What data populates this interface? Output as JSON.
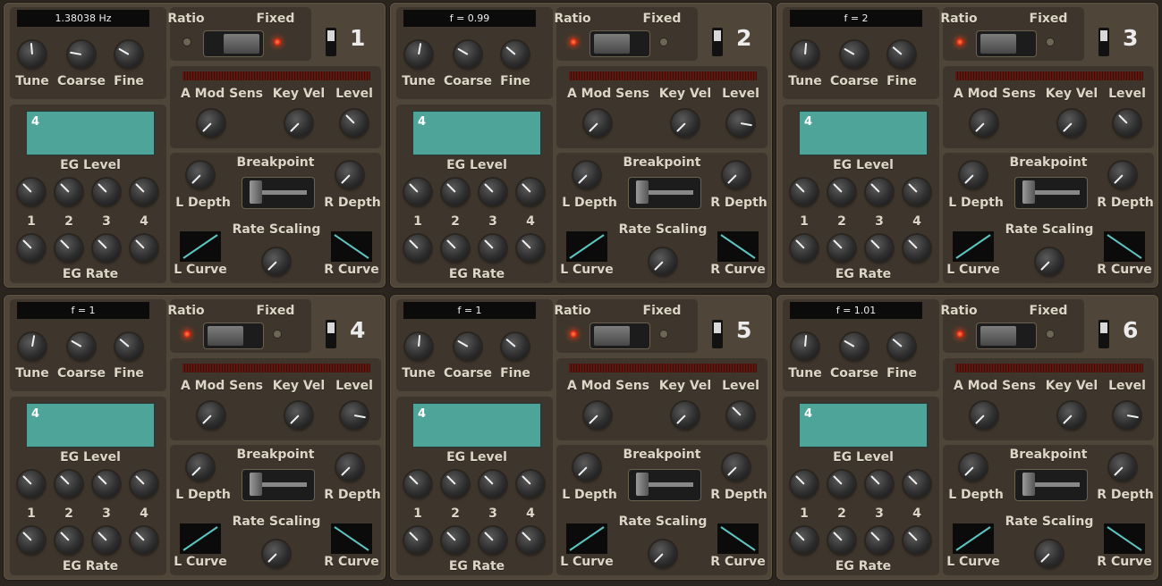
{
  "accent_colors": {
    "led_on": "#e02810",
    "screen": "#4fa49a",
    "panel": "#4f4538"
  },
  "labels": {
    "ratio": "Ratio",
    "fixed": "Fixed",
    "tune": "Tune",
    "coarse": "Coarse",
    "fine": "Fine",
    "a_mod_sens": "A Mod Sens",
    "key_vel": "Key Vel",
    "level": "Level",
    "eg_level": "EG Level",
    "eg_rate": "EG Rate",
    "breakpoint": "Breakpoint",
    "l_depth": "L Depth",
    "r_depth": "R Depth",
    "rate_scaling": "Rate Scaling",
    "l_curve": "L Curve",
    "r_curve": "R Curve",
    "stage_1": "1",
    "stage_2": "2",
    "stage_3": "3",
    "stage_4": "4"
  },
  "operators": [
    {
      "number": "1",
      "freq": "1.38038 Hz",
      "mode": "fixed",
      "screen_value": "4",
      "l_curve": "up",
      "r_curve": "down"
    },
    {
      "number": "2",
      "freq": "f = 0.99",
      "mode": "ratio",
      "screen_value": "4",
      "l_curve": "up",
      "r_curve": "down"
    },
    {
      "number": "3",
      "freq": "f = 2",
      "mode": "ratio",
      "screen_value": "4",
      "l_curve": "up",
      "r_curve": "down"
    },
    {
      "number": "4",
      "freq": "f = 1",
      "mode": "ratio",
      "screen_value": "4",
      "l_curve": "up",
      "r_curve": "down"
    },
    {
      "number": "5",
      "freq": "f = 1",
      "mode": "ratio",
      "screen_value": "4",
      "l_curve": "up",
      "r_curve": "down"
    },
    {
      "number": "6",
      "freq": "f = 1.01",
      "mode": "ratio",
      "screen_value": "4",
      "l_curve": "up",
      "r_curve": "down"
    }
  ]
}
